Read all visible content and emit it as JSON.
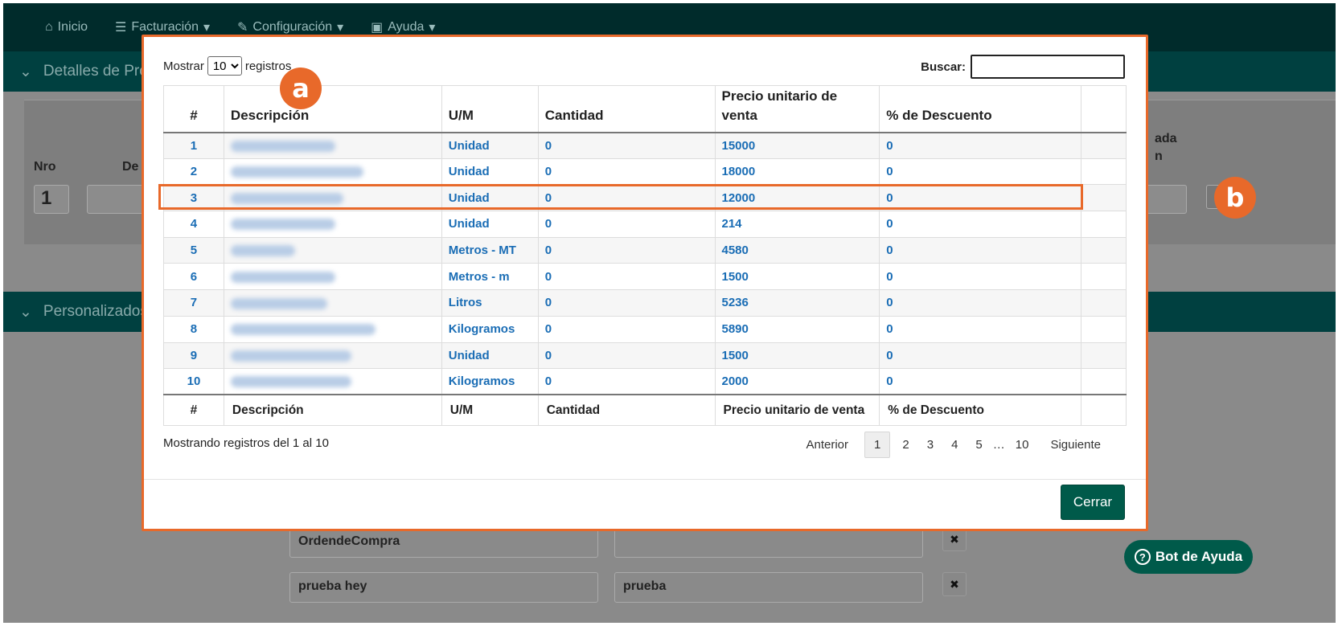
{
  "nav": {
    "items": [
      {
        "label": "Inicio",
        "icon": "home-icon"
      },
      {
        "label": "Facturación",
        "icon": "list-icon"
      },
      {
        "label": "Configuración",
        "icon": "wrench-icon"
      },
      {
        "label": "Ayuda",
        "icon": "book-icon"
      }
    ]
  },
  "background": {
    "section1": "Detalles de Pro",
    "section2": "Personalizados",
    "col_nro": "Nro",
    "col_de": "De",
    "col_right_1": "ada",
    "col_right_2": "n",
    "row_nro": "1",
    "field_1_name": "OrdendeCompra",
    "field_2_name": "prueba hey",
    "field_2_value": "prueba",
    "remove": "✖"
  },
  "modal": {
    "length": {
      "prefix": "Mostrar",
      "value": "10",
      "suffix": "registros",
      "options": [
        "10"
      ]
    },
    "search": {
      "label": "Buscar:",
      "value": ""
    },
    "columns": [
      "#",
      "Descripción",
      "U/M",
      "Cantidad",
      "Precio unitario de venta",
      "% de Descuento",
      ""
    ],
    "rows": [
      {
        "n": "1",
        "um": "Unidad",
        "cantidad": "0",
        "precio": "15000",
        "descuento": "0"
      },
      {
        "n": "2",
        "um": "Unidad",
        "cantidad": "0",
        "precio": "18000",
        "descuento": "0"
      },
      {
        "n": "3",
        "um": "Unidad",
        "cantidad": "0",
        "precio": "12000",
        "descuento": "0"
      },
      {
        "n": "4",
        "um": "Unidad",
        "cantidad": "0",
        "precio": "214",
        "descuento": "0"
      },
      {
        "n": "5",
        "um": "Metros - MT",
        "cantidad": "0",
        "precio": "4580",
        "descuento": "0"
      },
      {
        "n": "6",
        "um": "Metros - m",
        "cantidad": "0",
        "precio": "1500",
        "descuento": "0"
      },
      {
        "n": "7",
        "um": "Litros",
        "cantidad": "0",
        "precio": "5236",
        "descuento": "0"
      },
      {
        "n": "8",
        "um": "Kilogramos",
        "cantidad": "0",
        "precio": "5890",
        "descuento": "0"
      },
      {
        "n": "9",
        "um": "Unidad",
        "cantidad": "0",
        "precio": "1500",
        "descuento": "0"
      },
      {
        "n": "10",
        "um": "Kilogramos",
        "cantidad": "0",
        "precio": "2000",
        "descuento": "0"
      }
    ],
    "info": "Mostrando registros del 1 al 10",
    "pagination": {
      "prev": "Anterior",
      "pages": [
        "1",
        "2",
        "3",
        "4",
        "5",
        "…",
        "10"
      ],
      "current": "1",
      "next": "Siguiente"
    },
    "close": "Cerrar"
  },
  "annotations": {
    "a": "a",
    "b": "b",
    "color": "#e8692a"
  },
  "help_bot": {
    "label": "Bot de Ayuda",
    "icon": "question-circle-icon"
  },
  "colors": {
    "nav": "#002b2b",
    "section": "#004040",
    "accent": "#005a4a",
    "link": "#1a6db5"
  }
}
